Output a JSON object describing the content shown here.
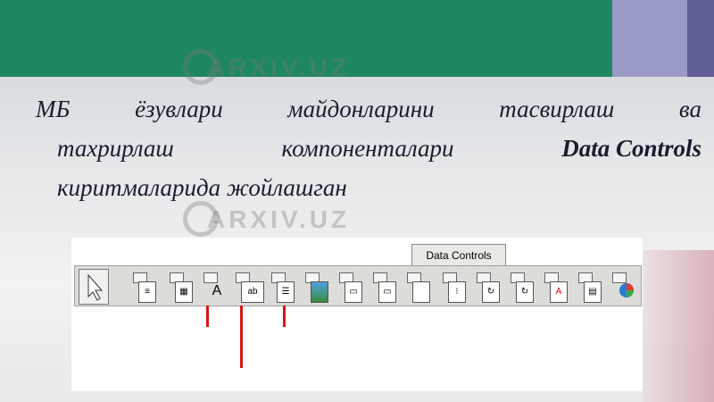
{
  "slide": {
    "line1": [
      "МБ",
      "ёзувлари",
      "майдонларини",
      "тасвирлаш",
      "ва"
    ],
    "line2": [
      "тахрирлаш",
      "компоненталари"
    ],
    "line2_bold": "Data Controls",
    "line3": "киритмаларида  жойлашган"
  },
  "watermark": {
    "text": "ARXIV.UZ"
  },
  "toolbar": {
    "tab_label": "Data Controls",
    "tools": [
      "pointer-tool",
      "list-tool",
      "grid-tool",
      "label-tool",
      "textbox-tool",
      "memo-tool",
      "image-tool",
      "combobox-tool",
      "lookup-combobox-tool",
      "checkbox-tool",
      "radio-group-tool",
      "navigator-tool",
      "dblookup-tool",
      "rich-edit-tool",
      "ctrl-grid-tool",
      "chart-tool"
    ],
    "textbox_glyph": "ab"
  },
  "colors": {
    "banner": "#1f8760",
    "accent_light": "#9a9cc7",
    "accent_dark": "#5e5d95",
    "marker": "#d31818"
  }
}
